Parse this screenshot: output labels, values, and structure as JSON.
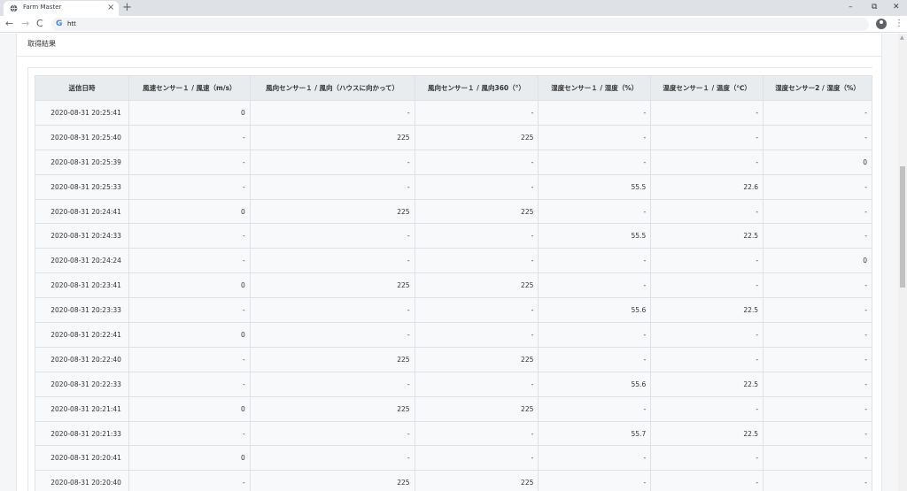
{
  "browser": {
    "tab_title": "Farm Master",
    "close_glyph": "×",
    "new_tab_glyph": "+",
    "url": "htt",
    "google_glyph": "G",
    "back_glyph": "←",
    "forward_glyph": "→",
    "reload_glyph": "C",
    "menu_glyph": "⋮",
    "minimize_glyph": "–",
    "maximize_glyph": "⧉",
    "window_close_glyph": "✕"
  },
  "card": {
    "title": "取得結果"
  },
  "table": {
    "columns": [
      "送信日時",
      "風速センサー１ / 風速（m/s）",
      "風向センサー１ / 風向（ハウスに向かって）",
      "風向センサー１ / 風向360（°）",
      "湿度センサー１ / 湿度（%）",
      "温度センサー１ / 温度（℃）",
      "湿度センサー2 / 湿度（%）"
    ],
    "rows": [
      [
        "2020-08-31 20:25:41",
        "0",
        "-",
        "-",
        "-",
        "-",
        "-"
      ],
      [
        "2020-08-31 20:25:40",
        "-",
        "225",
        "225",
        "-",
        "-",
        "-"
      ],
      [
        "2020-08-31 20:25:39",
        "-",
        "-",
        "-",
        "-",
        "-",
        "0"
      ],
      [
        "2020-08-31 20:25:33",
        "-",
        "-",
        "-",
        "55.5",
        "22.6",
        "-"
      ],
      [
        "2020-08-31 20:24:41",
        "0",
        "225",
        "225",
        "-",
        "-",
        "-"
      ],
      [
        "2020-08-31 20:24:33",
        "-",
        "-",
        "-",
        "55.5",
        "22.5",
        "-"
      ],
      [
        "2020-08-31 20:24:24",
        "-",
        "-",
        "-",
        "-",
        "-",
        "0"
      ],
      [
        "2020-08-31 20:23:41",
        "0",
        "225",
        "225",
        "-",
        "-",
        "-"
      ],
      [
        "2020-08-31 20:23:33",
        "-",
        "-",
        "-",
        "55.6",
        "22.5",
        "-"
      ],
      [
        "2020-08-31 20:22:41",
        "0",
        "-",
        "-",
        "-",
        "-",
        "-"
      ],
      [
        "2020-08-31 20:22:40",
        "-",
        "225",
        "225",
        "-",
        "-",
        "-"
      ],
      [
        "2020-08-31 20:22:33",
        "-",
        "-",
        "-",
        "55.6",
        "22.5",
        "-"
      ],
      [
        "2020-08-31 20:21:41",
        "0",
        "225",
        "225",
        "-",
        "-",
        "-"
      ],
      [
        "2020-08-31 20:21:33",
        "-",
        "-",
        "-",
        "55.7",
        "22.5",
        "-"
      ],
      [
        "2020-08-31 20:20:41",
        "0",
        "-",
        "-",
        "-",
        "-",
        "-"
      ],
      [
        "2020-08-31 20:20:40",
        "-",
        "225",
        "225",
        "-",
        "-",
        "-"
      ]
    ]
  },
  "scrollbar": {
    "up_glyph": "▲"
  }
}
